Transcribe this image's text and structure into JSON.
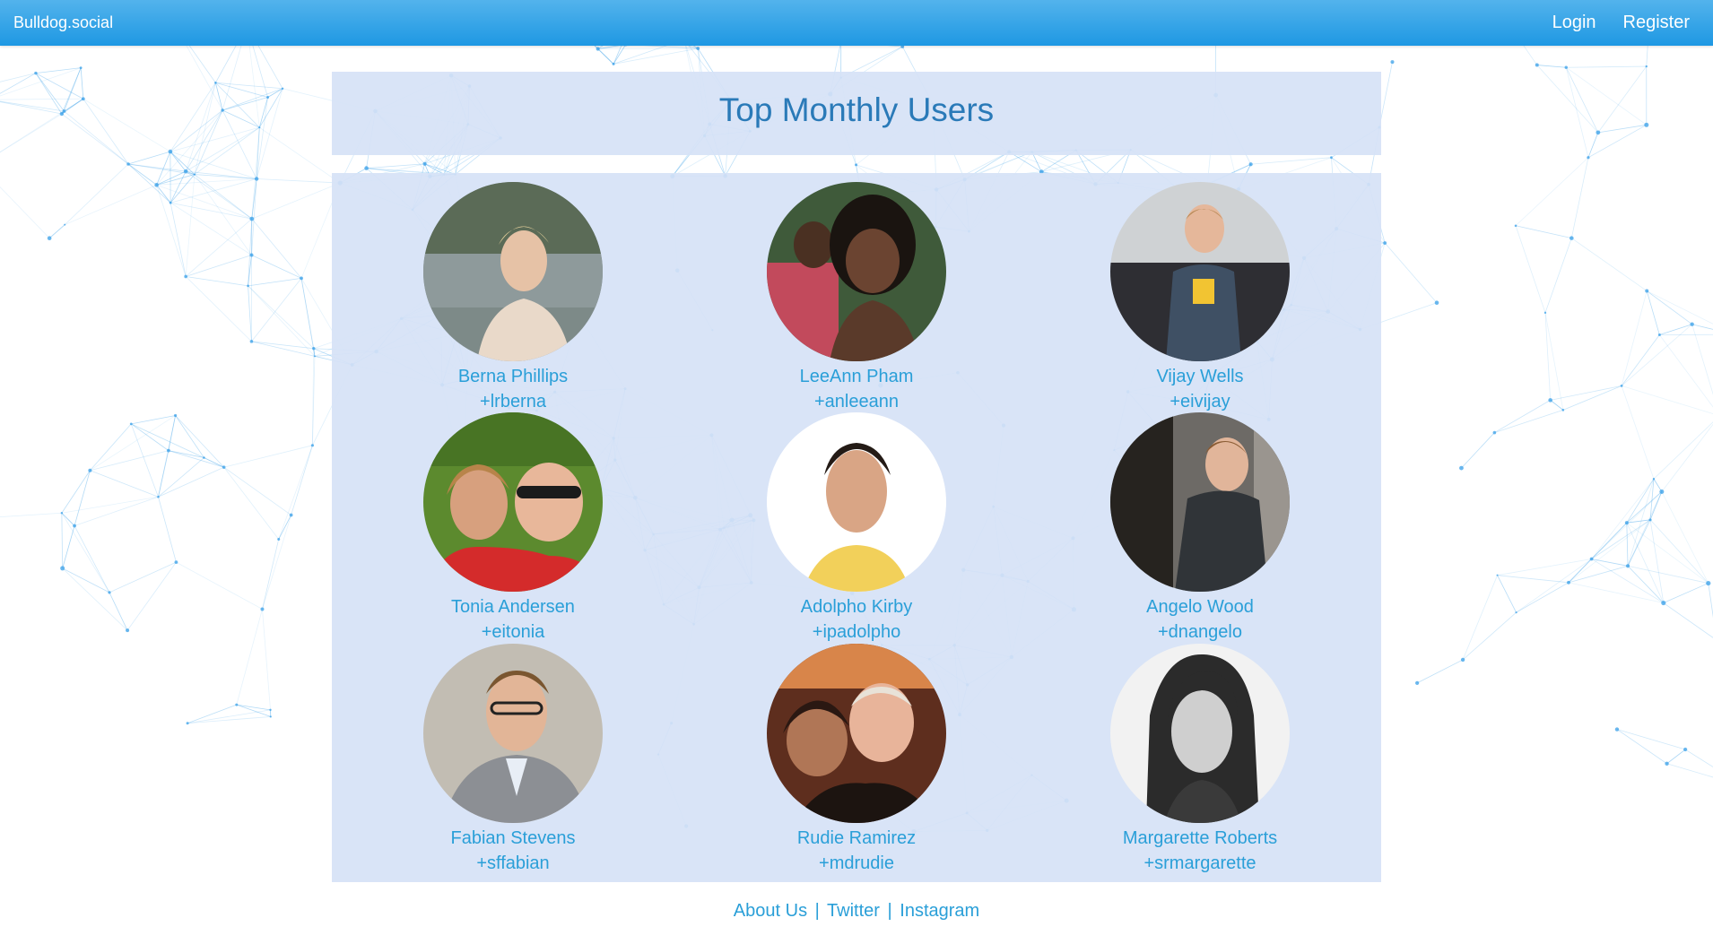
{
  "navbar": {
    "brand": "Bulldog.social",
    "login_label": "Login",
    "register_label": "Register"
  },
  "page": {
    "title": "Top Monthly Users"
  },
  "users": [
    {
      "name": "Berna Phillips",
      "handle": "+lrberna"
    },
    {
      "name": "LeeAnn Pham",
      "handle": "+anleeann"
    },
    {
      "name": "Vijay Wells",
      "handle": "+eivijay"
    },
    {
      "name": "Tonia Andersen",
      "handle": "+eitonia"
    },
    {
      "name": "Adolpho Kirby",
      "handle": "+ipadolpho"
    },
    {
      "name": "Angelo Wood",
      "handle": "+dnangelo"
    },
    {
      "name": "Fabian Stevens",
      "handle": "+sffabian"
    },
    {
      "name": "Rudie Ramirez",
      "handle": "+mdrudie"
    },
    {
      "name": "Margarette Roberts",
      "handle": "+srmargarette"
    }
  ],
  "footer": {
    "about_label": "About Us",
    "twitter_label": "Twitter",
    "instagram_label": "Instagram",
    "separator": "|"
  },
  "colors": {
    "navbar": "#1e98e3",
    "panel": "#d6e2f6",
    "title_text": "#2a7ab8",
    "link_text": "#2a9fd8",
    "network_lines": "#3aa0e8"
  }
}
